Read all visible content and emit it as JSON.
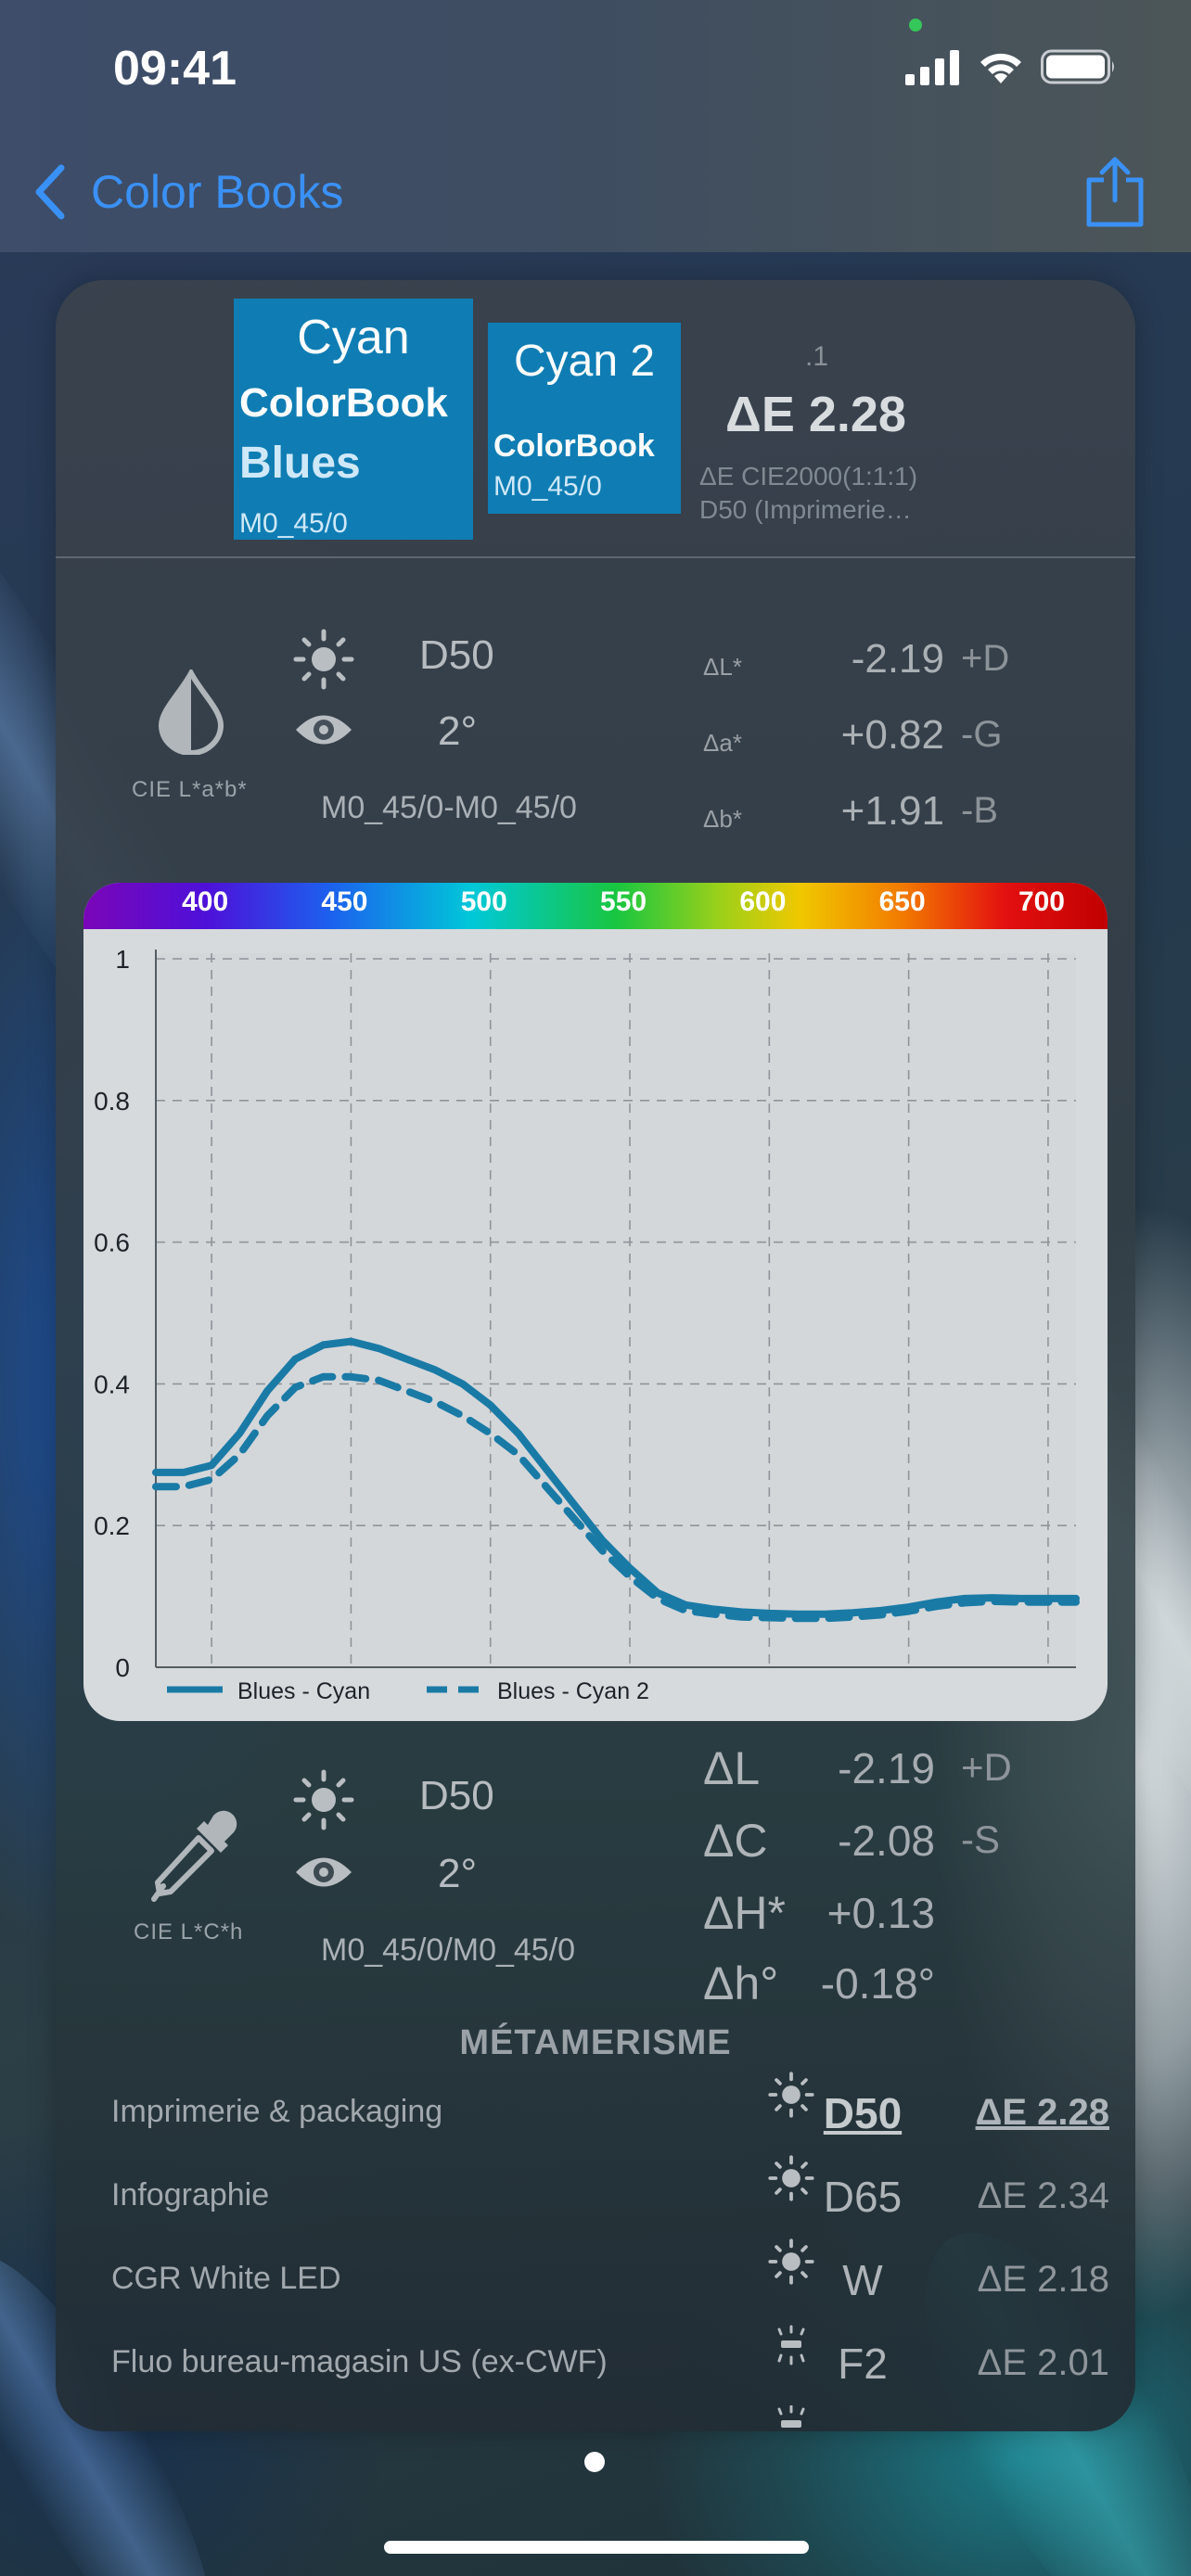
{
  "status_bar": {
    "time": "09:41"
  },
  "nav": {
    "back_label": "Color Books"
  },
  "header": {
    "swatch1": {
      "name": "Cyan",
      "book": "ColorBook",
      "group": "Blues",
      "condition": "M0_45/0"
    },
    "swatch2": {
      "name": "Cyan 2",
      "book": "ColorBook",
      "condition": "M0_45/0"
    },
    "delta_e_super": ".1",
    "delta_e": "ΔE 2.28",
    "formula": "ΔE CIE2000(1:1:1)",
    "illuminant_caption": "D50 (Imprimerie…"
  },
  "lab_section": {
    "space_label": "CIE L*a*b*",
    "illuminant": "D50",
    "observer": "2°",
    "conditions": "M0_45/0-M0_45/0",
    "deltas": [
      {
        "name": "ΔL*",
        "value": "-2.19",
        "tag": "+D"
      },
      {
        "name": "Δa*",
        "value": "+0.82",
        "tag": "-G"
      },
      {
        "name": "Δb*",
        "value": "+1.91",
        "tag": "-B"
      }
    ]
  },
  "chart_data": {
    "type": "line",
    "x_ticks": [
      400,
      450,
      500,
      550,
      600,
      650,
      700
    ],
    "y_ticks": [
      "0",
      "0.2",
      "0.4",
      "0.6",
      "0.8",
      "1"
    ],
    "xlim": [
      380,
      710
    ],
    "ylim": [
      0,
      1
    ],
    "grid": true,
    "legend_position": "bottom-left",
    "x": [
      380,
      390,
      400,
      410,
      420,
      430,
      440,
      450,
      460,
      470,
      480,
      490,
      500,
      510,
      520,
      530,
      540,
      550,
      560,
      570,
      580,
      590,
      600,
      610,
      620,
      630,
      640,
      650,
      660,
      670,
      680,
      690,
      700,
      710
    ],
    "series": [
      {
        "name": "Blues - Cyan",
        "style": "solid",
        "color": "#1a7aa6",
        "values": [
          0.275,
          0.275,
          0.285,
          0.33,
          0.39,
          0.435,
          0.455,
          0.46,
          0.45,
          0.435,
          0.42,
          0.4,
          0.37,
          0.33,
          0.28,
          0.23,
          0.18,
          0.14,
          0.105,
          0.088,
          0.082,
          0.078,
          0.076,
          0.075,
          0.075,
          0.077,
          0.08,
          0.085,
          0.092,
          0.097,
          0.098,
          0.097,
          0.097,
          0.097
        ]
      },
      {
        "name": "Blues - Cyan 2",
        "style": "dashed",
        "color": "#1a7aa6",
        "values": [
          0.255,
          0.255,
          0.265,
          0.3,
          0.355,
          0.395,
          0.41,
          0.41,
          0.405,
          0.39,
          0.375,
          0.355,
          0.33,
          0.3,
          0.255,
          0.21,
          0.165,
          0.128,
          0.097,
          0.08,
          0.075,
          0.071,
          0.07,
          0.069,
          0.069,
          0.071,
          0.074,
          0.079,
          0.086,
          0.091,
          0.093,
          0.092,
          0.092,
          0.092
        ]
      }
    ]
  },
  "lch_section": {
    "space_label": "CIE L*C*h",
    "illuminant": "D50",
    "observer": "2°",
    "conditions": "M0_45/0/M0_45/0",
    "deltas": [
      {
        "name": "ΔL",
        "value": "-2.19",
        "tag": "+D"
      },
      {
        "name": "ΔC",
        "value": "-2.08",
        "tag": "-S"
      },
      {
        "name": "ΔH*",
        "value": "+0.13",
        "tag": ""
      },
      {
        "name": "Δh°",
        "value": "-0.18°",
        "tag": ""
      }
    ]
  },
  "metamerism": {
    "title": "MÉTAMERISME",
    "rows": [
      {
        "name": "Imprimerie & packaging",
        "illuminant": "D50",
        "delta": "ΔE 2.28",
        "icon": "sun-icon",
        "active": true
      },
      {
        "name": "Infographie",
        "illuminant": "D65",
        "delta": "ΔE 2.34",
        "icon": "sun-icon",
        "active": false
      },
      {
        "name": "CGR White LED",
        "illuminant": "W",
        "delta": "ΔE 2.18",
        "icon": "sun-icon",
        "active": false
      },
      {
        "name": "Fluo bureau-magasin US (ex-CWF)",
        "illuminant": "F2",
        "delta": "ΔE 2.01",
        "icon": "fluorescent-icon",
        "active": false
      }
    ]
  }
}
